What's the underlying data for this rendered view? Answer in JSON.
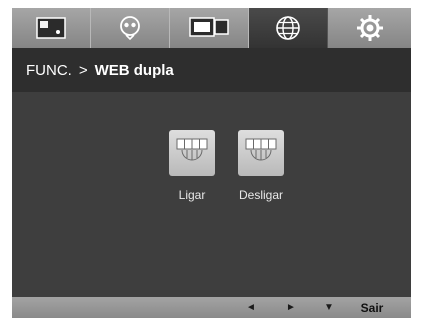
{
  "tabs": [
    {
      "icon": "picture-icon",
      "active": false
    },
    {
      "icon": "eye-icon",
      "active": false
    },
    {
      "icon": "dual-screen-icon",
      "active": false
    },
    {
      "icon": "globe-icon",
      "active": true
    },
    {
      "icon": "gear-icon",
      "active": false
    }
  ],
  "breadcrumb": {
    "section": "FUNC.",
    "separator": ">",
    "current": "WEB dupla"
  },
  "options": [
    {
      "label": "Ligar",
      "icon": "dual-web-on-icon"
    },
    {
      "label": "Desligar",
      "icon": "dual-web-off-icon"
    }
  ],
  "controls": {
    "left": "◄",
    "right": "►",
    "down": "▼",
    "exit": "Sair"
  },
  "colors": {
    "panel": "#3d3d3d",
    "title_bar": "#2e2e2e",
    "tab_active": "#3a3a3a",
    "tab_inactive": "#959595"
  }
}
